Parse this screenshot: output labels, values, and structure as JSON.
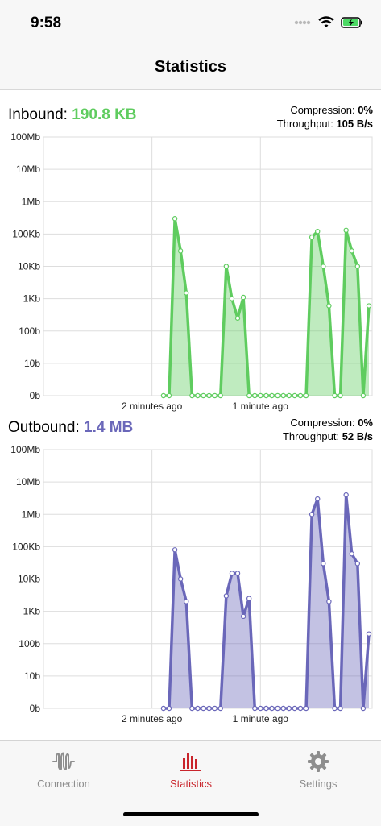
{
  "status": {
    "time": "9:58"
  },
  "nav": {
    "title": "Statistics"
  },
  "colors": {
    "inbound": "#5fcc5f",
    "outbound": "#6a67b9",
    "active_tab": "#c9252c",
    "inactive_tab": "#8e8e8e"
  },
  "inbound": {
    "label": "Inbound:",
    "total": "190.8 KB",
    "compression_label": "Compression:",
    "compression": "0%",
    "throughput_label": "Throughput:",
    "throughput": "105 B/s"
  },
  "outbound": {
    "label": "Outbound:",
    "total": "1.4 MB",
    "compression_label": "Compression:",
    "compression": "0%",
    "throughput_label": "Throughput:",
    "throughput": "52 B/s"
  },
  "chart_data": [
    {
      "type": "area",
      "y_scale": "log",
      "y_ticks": [
        "100Mb",
        "10Mb",
        "1Mb",
        "100Kb",
        "10Kb",
        "1Kb",
        "100b",
        "10b",
        "0b"
      ],
      "x_ticks": [
        "2 minutes ago",
        "1 minute ago"
      ],
      "grid": true,
      "series": [
        {
          "values": [
            0,
            0,
            300000,
            30000,
            1500,
            0,
            0,
            0,
            0,
            0,
            0,
            10000,
            1000,
            250,
            1100,
            0,
            0,
            0,
            0,
            0,
            0,
            0,
            0,
            0,
            0,
            0,
            80000,
            120000,
            10000,
            600,
            0,
            0,
            130000,
            30000,
            10000,
            0,
            600
          ]
        }
      ]
    },
    {
      "type": "area",
      "y_scale": "log",
      "y_ticks": [
        "100Mb",
        "10Mb",
        "1Mb",
        "100Kb",
        "10Kb",
        "1Kb",
        "100b",
        "10b",
        "0b"
      ],
      "x_ticks": [
        "2 minutes ago",
        "1 minute ago"
      ],
      "grid": true,
      "series": [
        {
          "values": [
            0,
            0,
            80000,
            10000,
            2000,
            0,
            0,
            0,
            0,
            0,
            0,
            3000,
            15000,
            15000,
            700,
            2500,
            0,
            0,
            0,
            0,
            0,
            0,
            0,
            0,
            0,
            0,
            1000000,
            3000000,
            30000,
            2000,
            0,
            0,
            4000000,
            60000,
            30000,
            0,
            200
          ]
        }
      ]
    }
  ],
  "tabs": [
    {
      "label": "Connection",
      "icon": "waveform-icon"
    },
    {
      "label": "Statistics",
      "icon": "bar-chart-icon"
    },
    {
      "label": "Settings",
      "icon": "gear-icon"
    }
  ]
}
